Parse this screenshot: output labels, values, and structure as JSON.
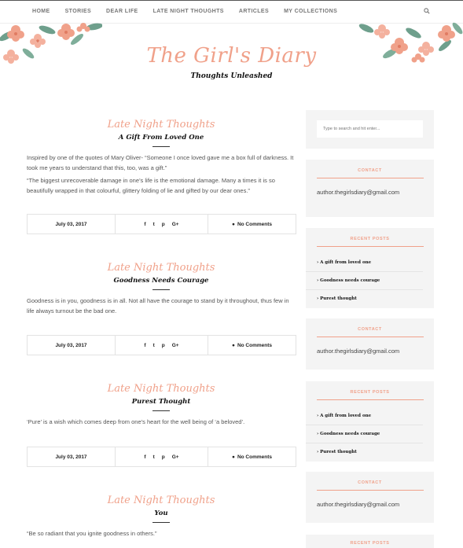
{
  "nav": {
    "items": [
      "HOME",
      "STORIES",
      "DEAR LIFE",
      "LATE NIGHT THOUGHTS",
      "ARTICLES",
      "MY COLLECTIONS"
    ],
    "search_icon": "search-icon"
  },
  "header": {
    "title": "The Girl's Diary",
    "tagline": "Thoughts Unleashed"
  },
  "colors": {
    "accent": "#f0a18a",
    "leaf": "#6e9f8c"
  },
  "posts": [
    {
      "category": "Late Night Thoughts",
      "title": "A Gift From Loved One",
      "body": [
        "Inspired by one of the quotes of Mary Oliver- “Someone I once loved gave me a box full of darkness. It took me years to understand that this, too, was a gift.”",
        "“The biggest unrecoverable damage in one’s life is the emotional damage. Many a times it is so beautifully wrapped in that colourful, glittery folding of lie and gifted by our dear ones.”"
      ],
      "date": "July 03, 2017",
      "comments": "No Comments"
    },
    {
      "category": "Late Night Thoughts",
      "title": "Goodness Needs Courage",
      "body": [
        "Goodness is in you, goodness is in all. Not all have the courage to stand by it throughout, thus few in life always turnout be the bad one."
      ],
      "date": "July 03, 2017",
      "comments": "No Comments"
    },
    {
      "category": "Late Night Thoughts",
      "title": "Purest Thought",
      "body": [
        "‘Pure’ is a wish which comes deep from one’s heart for the well being of ‘a beloved’."
      ],
      "date": "July 03, 2017",
      "comments": "No Comments"
    },
    {
      "category": "Late Night Thoughts",
      "title": "You",
      "body": [
        "“Be so radiant that you ignite goodness in others.”"
      ]
    }
  ],
  "share_icons": [
    "f",
    "t",
    "p",
    "G+"
  ],
  "sidebar": {
    "search_placeholder": "Type to search and hit enter...",
    "contact_title": "CONTACT",
    "email": "author.thegirlsdiary@gmail.com",
    "recent_title": "RECENT POSTS",
    "recent_posts": [
      "A gift from loved one",
      "Goodness needs courage",
      "Purest thought"
    ]
  }
}
